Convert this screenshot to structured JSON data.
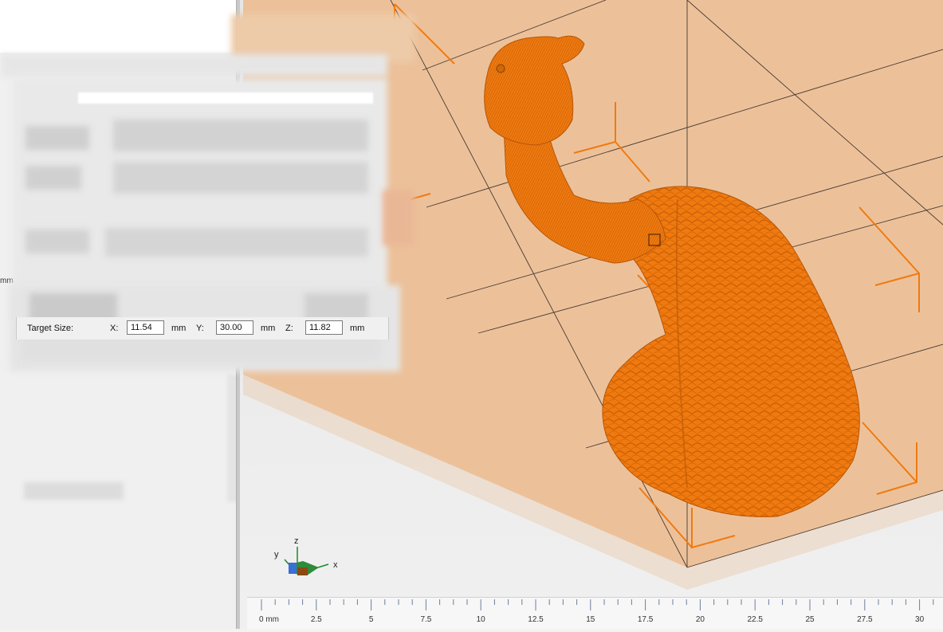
{
  "dialog": {
    "target_size_label": "Target Size:",
    "x_label": "X:",
    "x_value": "11.54",
    "y_label": "Y:",
    "y_value": "30.00",
    "z_label": "Z:",
    "z_value": "11.82",
    "unit": "mm"
  },
  "left_edge_unit": "mm",
  "axis_gizmo": {
    "x": "x",
    "y": "y",
    "z": "z"
  },
  "ruler": {
    "ticks": [
      "0 mm",
      "2.5",
      "5",
      "7.5",
      "10",
      "12.5",
      "15",
      "17.5",
      "20",
      "22.5",
      "25",
      "27.5",
      "30"
    ]
  },
  "colors": {
    "model": "#f07a10",
    "build_volume": "#ecc19a",
    "bounding_box": "#f07a10"
  }
}
